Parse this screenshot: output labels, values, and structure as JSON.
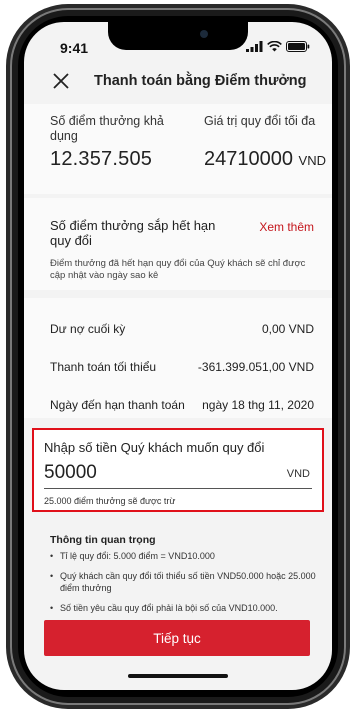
{
  "status": {
    "time": "9:41"
  },
  "header": {
    "title": "Thanh toán bằng Điểm thưởng"
  },
  "points": {
    "available_label": "Số điểm thưởng khả dụng",
    "available_value": "12.357.505",
    "max_value_label": "Giá trị quy đổi tối đa",
    "max_value": "24710000",
    "max_value_unit": "VND"
  },
  "expiring": {
    "title": "Số điểm thưởng sắp hết hạn quy đổi",
    "link": "Xem thêm",
    "note": "Điểm thưởng đã hết hạn quy đổi của Quý khách sẽ chỉ được cập nhật vào ngày sao kê"
  },
  "statement": {
    "rows": [
      {
        "label": "Dư nợ cuối kỳ",
        "value": "0,00 VND"
      },
      {
        "label": "Thanh toán tối thiểu",
        "value": "-361.399.051,00 VND"
      },
      {
        "label": "Ngày đến hạn thanh toán",
        "value": "ngày 18 thg 11, 2020"
      }
    ]
  },
  "amount_input": {
    "label": "Nhập số tiền Quý khách muốn quy đổi",
    "value": "50000",
    "unit": "VND",
    "hint": "25.000 điểm thưởng sẽ được trừ"
  },
  "info": {
    "title": "Thông tin quan trọng",
    "items": [
      "Tỉ lệ quy đổi: 5.000 điểm = VND10.000",
      "Quý khách cần quy đổi tối thiểu số tiền VND50.000 hoặc 25.000 điểm thưởng",
      "Số tiền yêu cầu quy đổi phải là bội số của VND10.000."
    ]
  },
  "continue_button": {
    "label": "Tiếp tục"
  },
  "colors": {
    "accent": "#d6212e",
    "highlight_border": "#e0101a",
    "link": "#c4161c"
  }
}
